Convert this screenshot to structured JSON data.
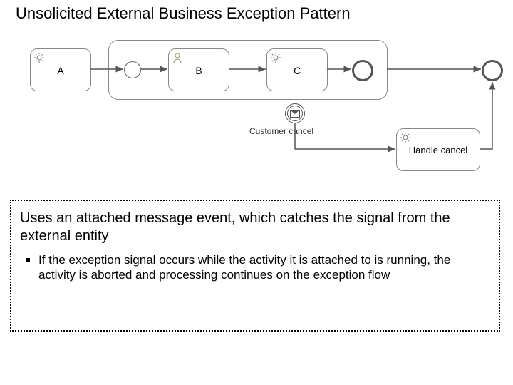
{
  "title": "Unsolicited External Business Exception Pattern",
  "diagram": {
    "taskA": "A",
    "taskB": "B",
    "taskC": "C",
    "handleCancel": "Handle cancel",
    "boundaryEventLabel": "Customer cancel"
  },
  "summary": "Uses an attached message event, which catches the signal from the external entity",
  "detail": "If the exception signal occurs while the activity it is attached to is running, the activity is aborted and processing continues on the exception flow"
}
